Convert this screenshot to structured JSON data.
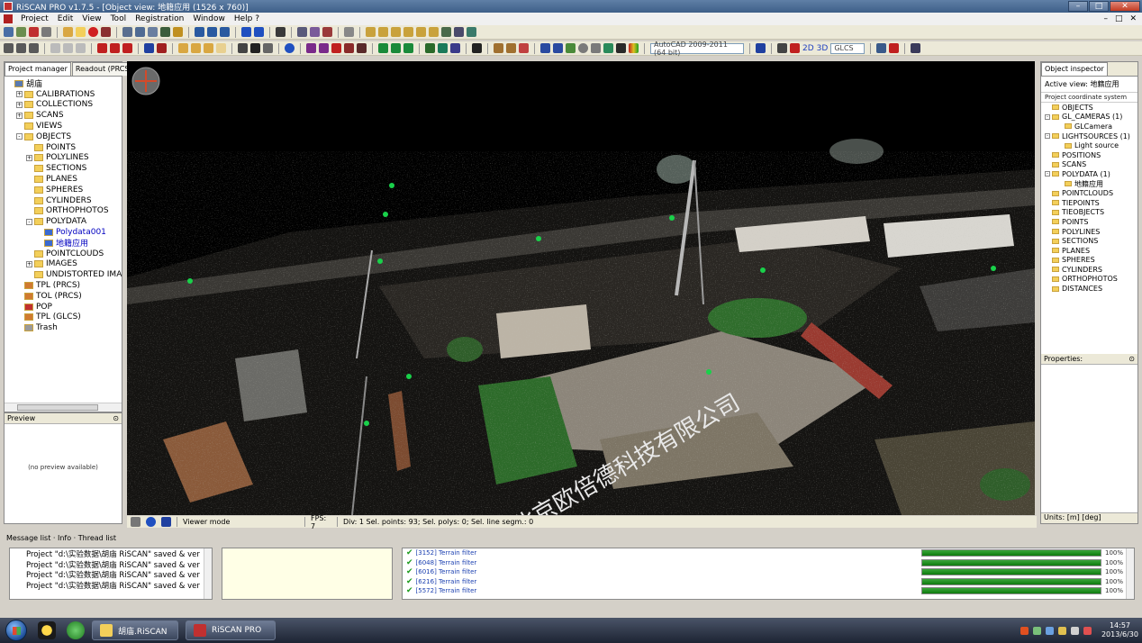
{
  "window": {
    "title": "RiSCAN PRO v1.7.5 - [Object view: 地籍应用 (1526 x 760)]",
    "controls": {
      "minimize": "–",
      "maximize": "□",
      "close": "✕"
    }
  },
  "menubar": {
    "items": [
      "Project",
      "Edit",
      "View",
      "Tool",
      "Registration",
      "Window",
      "Help ?"
    ],
    "right_controls": [
      "–",
      "□",
      "✕"
    ]
  },
  "toolbar2": {
    "combo_driver": "AutoCAD 2009-2011 (64 bit)",
    "btn_2d": "2D",
    "btn_3d": "3D",
    "combo_coords": "GLCS"
  },
  "left_panel": {
    "tabs": [
      "Project manager",
      "Readout (PRCS)"
    ],
    "tree": [
      {
        "label": "胡庙",
        "level": 0,
        "expander": "",
        "icon": "scanner"
      },
      {
        "label": "CALIBRATIONS",
        "level": 1,
        "expander": "+",
        "icon": "folder"
      },
      {
        "label": "COLLECTIONS",
        "level": 1,
        "expander": "+",
        "icon": "folder"
      },
      {
        "label": "SCANS",
        "level": 1,
        "expander": "+",
        "icon": "folder"
      },
      {
        "label": "VIEWS",
        "level": 1,
        "expander": "",
        "icon": "folder"
      },
      {
        "label": "OBJECTS",
        "level": 1,
        "expander": "-",
        "icon": "folder"
      },
      {
        "label": "POINTS",
        "level": 2,
        "expander": "",
        "icon": "folder"
      },
      {
        "label": "POLYLINES",
        "level": 2,
        "expander": "+",
        "icon": "folder"
      },
      {
        "label": "SECTIONS",
        "level": 2,
        "expander": "",
        "icon": "folder"
      },
      {
        "label": "PLANES",
        "level": 2,
        "expander": "",
        "icon": "folder"
      },
      {
        "label": "SPHERES",
        "level": 2,
        "expander": "",
        "icon": "folder"
      },
      {
        "label": "CYLINDERS",
        "level": 2,
        "expander": "",
        "icon": "folder"
      },
      {
        "label": "ORTHOPHOTOS",
        "level": 2,
        "expander": "",
        "icon": "folder"
      },
      {
        "label": "POLYDATA",
        "level": 2,
        "expander": "-",
        "icon": "folder"
      },
      {
        "label": "Polydata001",
        "level": 3,
        "expander": "",
        "icon": "polydata",
        "selected": true
      },
      {
        "label": "地籍应用",
        "level": 3,
        "expander": "",
        "icon": "polydata",
        "selected": true
      },
      {
        "label": "POINTCLOUDS",
        "level": 2,
        "expander": "",
        "icon": "folder"
      },
      {
        "label": "IMAGES",
        "level": 2,
        "expander": "+",
        "icon": "folder"
      },
      {
        "label": "UNDISTORTED IMAGE",
        "level": 2,
        "expander": "",
        "icon": "folder"
      },
      {
        "label": "TPL (PRCS)",
        "level": 1,
        "expander": "",
        "icon": "tpl"
      },
      {
        "label": "TOL (PRCS)",
        "level": 1,
        "expander": "",
        "icon": "tpl"
      },
      {
        "label": "POP",
        "level": 1,
        "expander": "",
        "icon": "pop"
      },
      {
        "label": "TPL (GLCS)",
        "level": 1,
        "expander": "",
        "icon": "tpl"
      },
      {
        "label": "Trash",
        "level": 1,
        "expander": "",
        "icon": "trash"
      }
    ],
    "preview_title": "Preview",
    "preview_message": "(no preview available)"
  },
  "viewer": {
    "watermark": "北京欧倍德科技有限公司"
  },
  "statusbar": {
    "mode": "Viewer mode",
    "fps": "FPS: 7",
    "selection": "Div: 1 Sel. points: 93; Sel. polys: 0; Sel. line segm.: 0"
  },
  "right_panel": {
    "tab": "Object inspector",
    "active_view": "Active view: 地籍应用",
    "coord_system": "Project coordinate system",
    "tree": [
      {
        "label": "OBJECTS",
        "level": 0,
        "expander": ""
      },
      {
        "label": "GL_CAMERAS (1)",
        "level": 0,
        "expander": "-"
      },
      {
        "label": "GLCamera",
        "level": 1,
        "expander": ""
      },
      {
        "label": "LIGHTSOURCES (1)",
        "level": 0,
        "expander": "-"
      },
      {
        "label": "Light source",
        "level": 1,
        "expander": ""
      },
      {
        "label": "POSITIONS",
        "level": 0,
        "expander": ""
      },
      {
        "label": "SCANS",
        "level": 0,
        "expander": ""
      },
      {
        "label": "POLYDATA (1)",
        "level": 0,
        "expander": "-"
      },
      {
        "label": "地籍应用",
        "level": 1,
        "expander": ""
      },
      {
        "label": "POINTCLOUDS",
        "level": 0,
        "expander": ""
      },
      {
        "label": "TIEPOINTS",
        "level": 0,
        "expander": ""
      },
      {
        "label": "TIEOBJECTS",
        "level": 0,
        "expander": ""
      },
      {
        "label": "POINTS",
        "level": 0,
        "expander": ""
      },
      {
        "label": "POLYLINES",
        "level": 0,
        "expander": ""
      },
      {
        "label": "SECTIONS",
        "level": 0,
        "expander": ""
      },
      {
        "label": "PLANES",
        "level": 0,
        "expander": ""
      },
      {
        "label": "SPHERES",
        "level": 0,
        "expander": ""
      },
      {
        "label": "CYLINDERS",
        "level": 0,
        "expander": ""
      },
      {
        "label": "ORTHOPHOTOS",
        "level": 0,
        "expander": ""
      },
      {
        "label": "DISTANCES",
        "level": 0,
        "expander": ""
      }
    ],
    "properties_title": "Properties:",
    "units": "Units: [m] [deg]"
  },
  "message_area": {
    "tabs_label": "Message list · Info · Thread list",
    "messages": [
      "Project \"d:\\实验数据\\胡庙 RiSCAN\" saved & ver",
      "Project \"d:\\实验数据\\胡庙 RiSCAN\" saved & ver",
      "Project \"d:\\实验数据\\胡庙 RiSCAN\" saved & ver",
      "Project \"d:\\实验数据\\胡庙 RiSCAN\" saved & ver"
    ],
    "threads": [
      {
        "label": "[3152] Terrain filter",
        "progress": 1.0,
        "percent": "100%"
      },
      {
        "label": "[6048] Terrain filter",
        "progress": 1.0,
        "percent": "100%"
      },
      {
        "label": "[6016] Terrain filter",
        "progress": 1.0,
        "percent": "100%"
      },
      {
        "label": "[6216] Terrain filter",
        "progress": 1.0,
        "percent": "100%"
      },
      {
        "label": "[5572] Terrain filter",
        "progress": 1.0,
        "percent": "100%"
      }
    ]
  },
  "taskbar": {
    "buttons": [
      "胡庙.RiSCAN",
      "RiSCAN PRO"
    ],
    "time": "14:57",
    "date": "2013/6/30"
  },
  "colors": {
    "title_bar": "#3e5f88",
    "progress_green": "#0e7a0e",
    "selected_tree_text": "#0000c0",
    "check_green": "#1a9a1a",
    "viewer_bg": "#000000"
  }
}
